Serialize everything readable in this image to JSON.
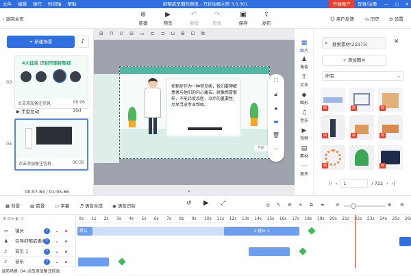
{
  "titlebar": {
    "menu": [
      "文件",
      "编辑",
      "操作",
      "时间轴",
      "帮助"
    ],
    "title": "抑郁症早期的表现 - 万彩动画大师 3.0.301",
    "upgrade": "升级账户",
    "login": "登录/注册",
    "window_controls": [
      "—",
      "▢",
      "✕"
    ]
  },
  "toolbar": {
    "back": "返回主页",
    "new": "新建",
    "preview": "预览",
    "undo": "撤销",
    "redo": "恢复",
    "save": "保存",
    "publish": "发布",
    "feedback": "用户反馈",
    "history": "历史",
    "settings": "设置"
  },
  "leftpanel": {
    "new_scene": "+ 新建场景",
    "scenes": [
      {
        "num": "03",
        "caption": "点击添加备注信息",
        "duration": "00:06",
        "title": "4大征兆 识别早期抑郁症"
      },
      {
        "num": "04",
        "caption": "点击添加备注信息",
        "duration": "00:30"
      }
    ],
    "transition": "手型拉动",
    "transition_time": "1(s)",
    "time": "00:57.83 / 01:05.66"
  },
  "stage": {
    "text": "抑郁症作为一种常见病，我们要理解患者与他们的内心痛苦。就像感冒那样，不能讳疾忌医，治疗的重要性，尽早寻求专业帮助。",
    "logo": "万彩"
  },
  "rightnav": {
    "items": [
      "图片",
      "角色",
      "文本",
      "图形",
      "音乐",
      "视频",
      "素材",
      "更多"
    ]
  },
  "assets": {
    "search": "搜索素材(25975)",
    "add": "+ 添加图片",
    "category": "所有",
    "page": "1",
    "total": "/ 722",
    "tag": "商"
  },
  "bottombar": {
    "items": [
      "背景",
      "前景",
      "字幕",
      "语音合成",
      "语音识别"
    ]
  },
  "timeline": {
    "tracks": [
      "镜头",
      "引导抑郁症患者...",
      "音乐 1",
      "音乐"
    ],
    "ticks": [
      "0s",
      "1s",
      "2s",
      "3s",
      "4s",
      "5s",
      "6s",
      "7s",
      "8s",
      "9s",
      "10s",
      "11s",
      "12s",
      "13s",
      "14s",
      "15s",
      "16s",
      "17s",
      "18s",
      "19s",
      "20s",
      "21s",
      "22s",
      "23s",
      "24s",
      "25s",
      "26s"
    ],
    "default_clip": "默认",
    "camera_clip": "1 镜头 1"
  },
  "statusbar": {
    "text": "当前场景: 04    点击添加备注信息"
  }
}
